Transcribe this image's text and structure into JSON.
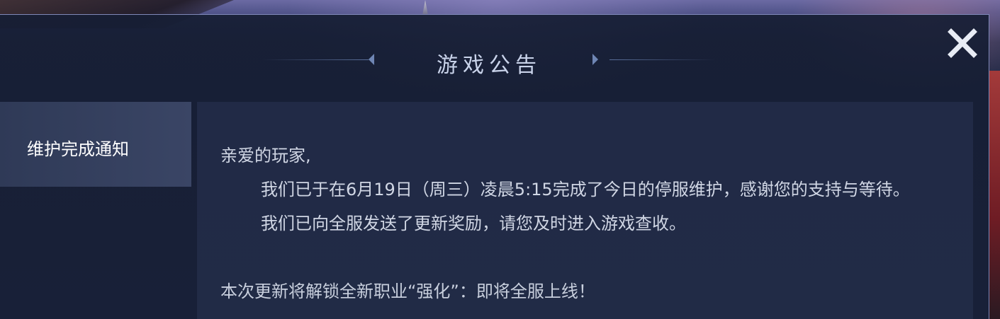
{
  "dialog": {
    "title": "游戏公告",
    "close_icon": "close-icon"
  },
  "sidebar": {
    "items": [
      {
        "label": "维护完成通知",
        "selected": true
      }
    ]
  },
  "announcement": {
    "greeting": "亲爱的玩家,",
    "paragraph1": "我们已于在6月19日（周三）凌晨5:15完成了今日的停服维护，感谢您的支持与等待。",
    "paragraph2": "我们已向全服发送了更新奖励，请您及时进入游戏查收。",
    "paragraph3_partial": "本次更新将解锁全新职业“强化”：即将全服上线！"
  },
  "colors": {
    "accent": "#7f88b8",
    "panel": "#242e4a",
    "text": "#d0d6e4"
  }
}
